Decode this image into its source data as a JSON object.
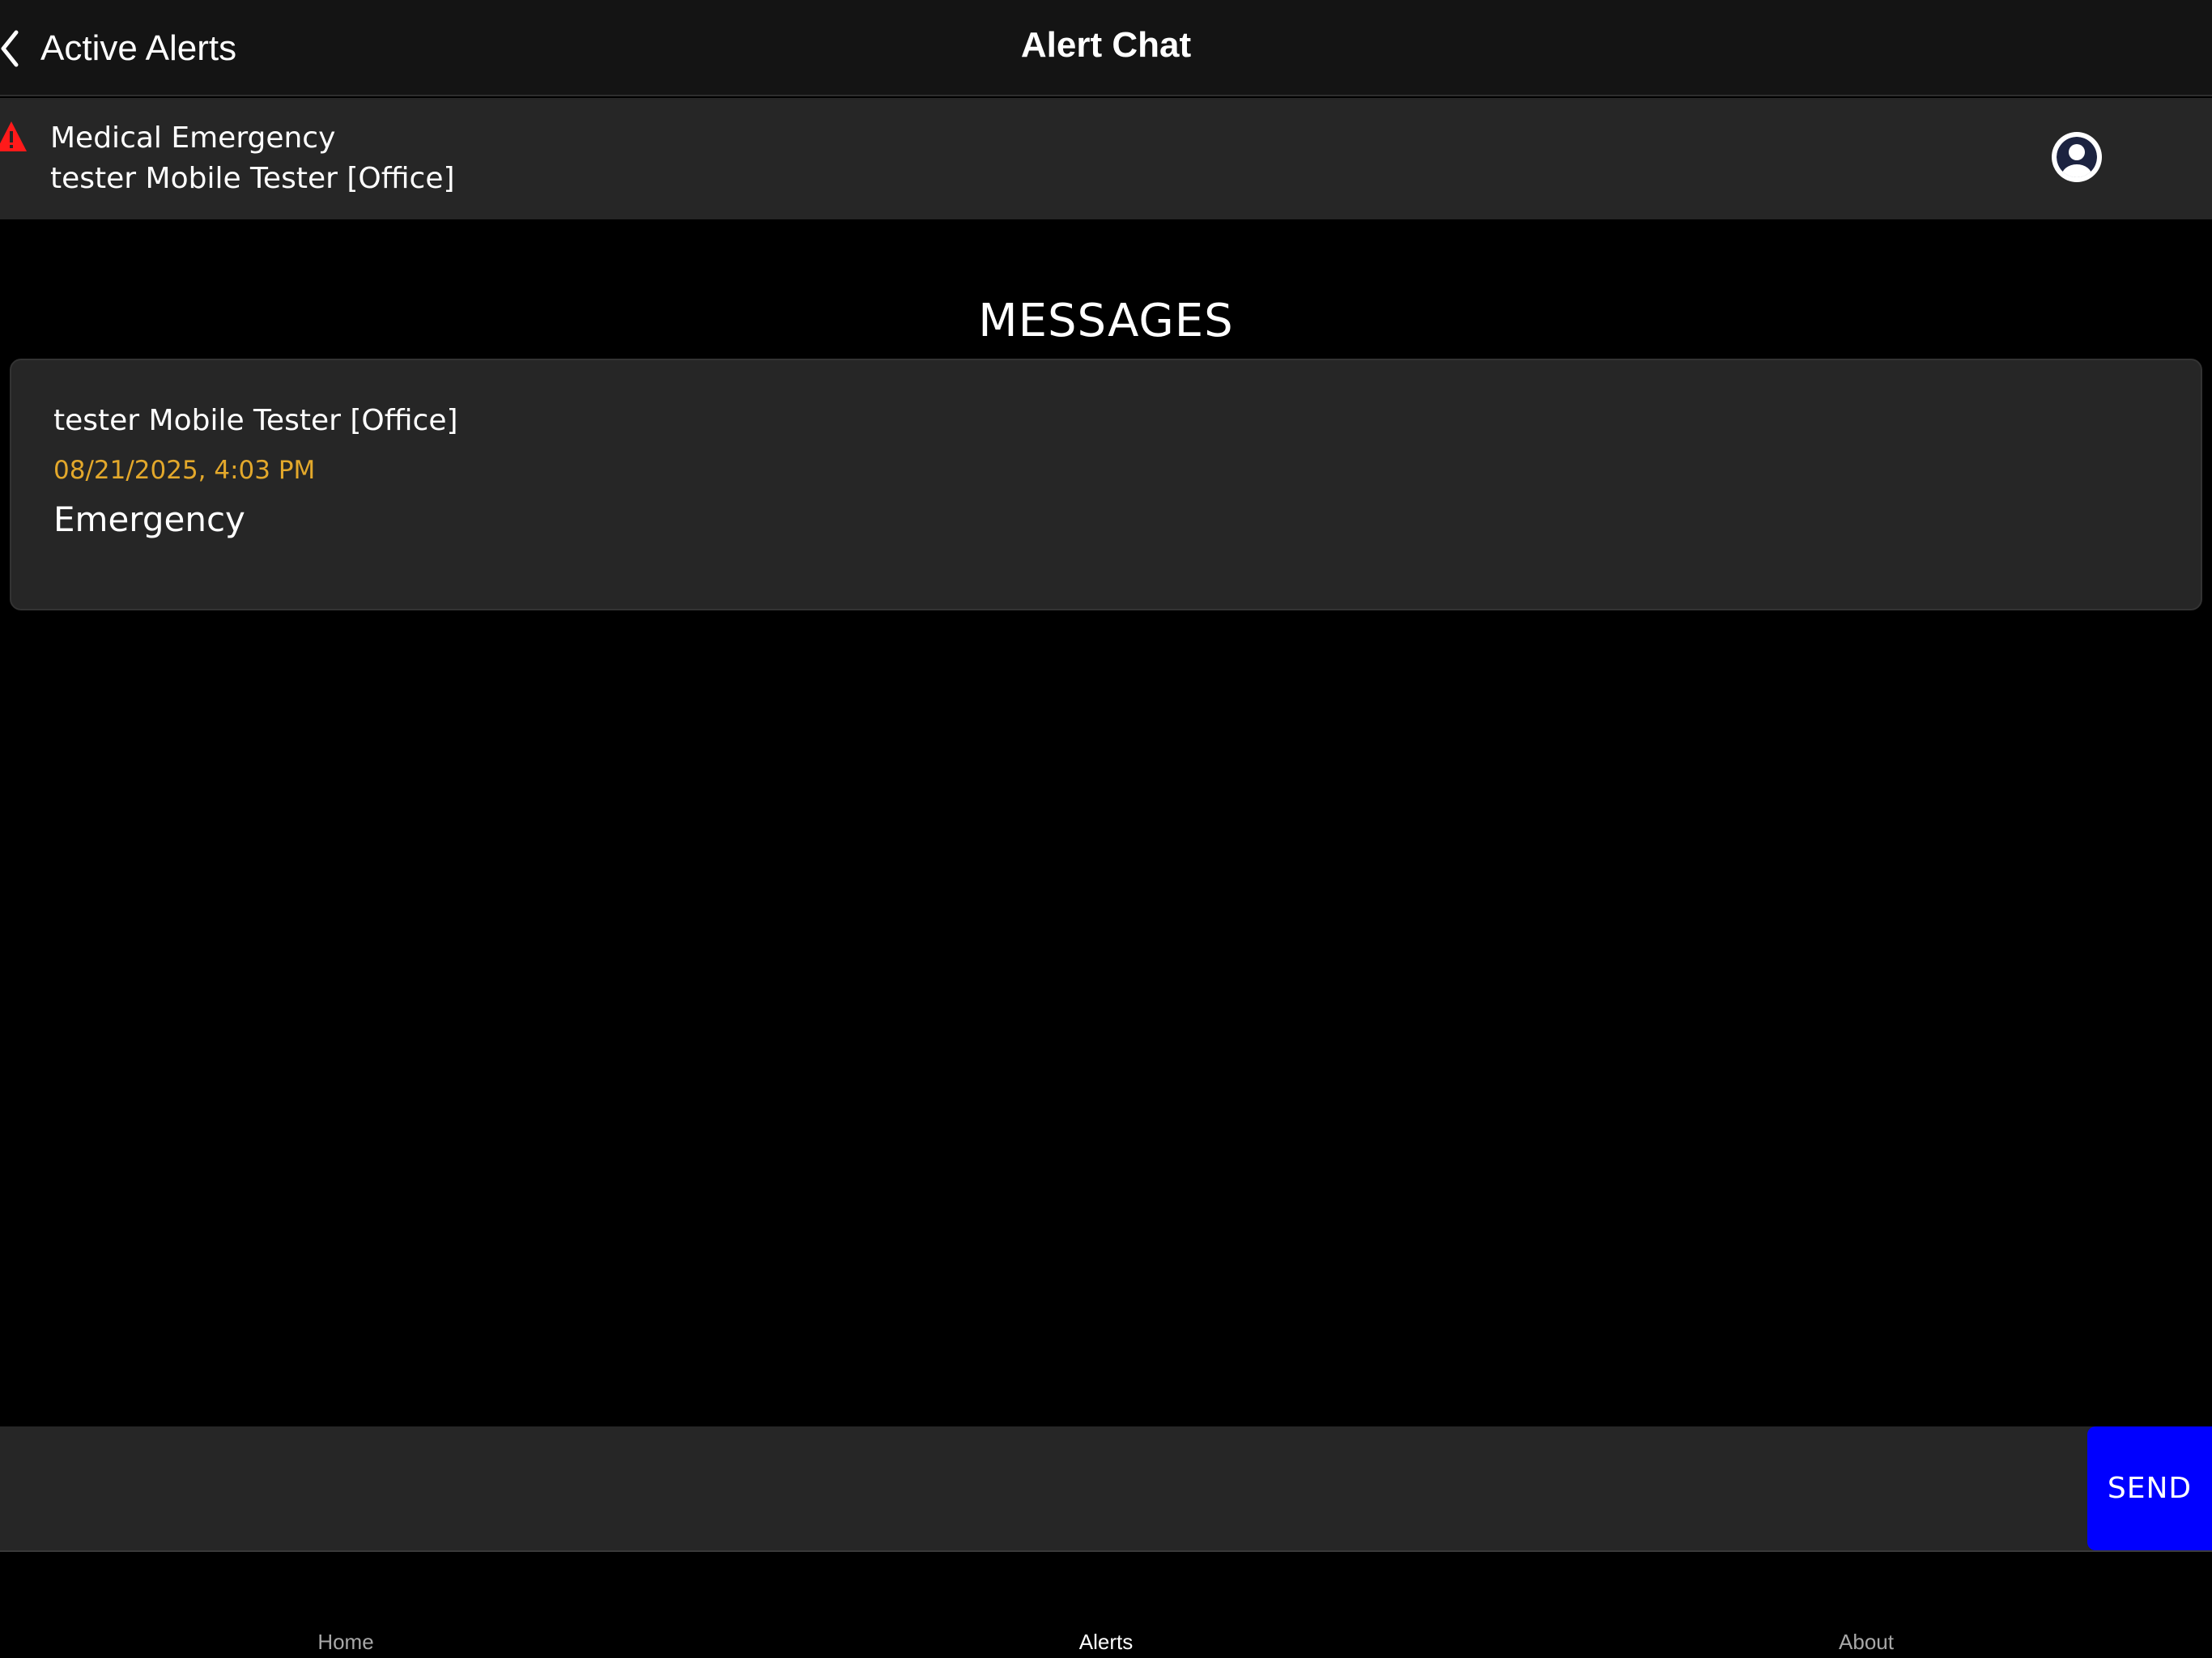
{
  "nav": {
    "back_label": "Active Alerts",
    "title": "Alert Chat"
  },
  "alert": {
    "type": "Medical Emergency",
    "reporter": "tester Mobile Tester [Office]",
    "icon": "warning-icon",
    "icon_color": "#ff1a1a"
  },
  "messages": {
    "heading": "MESSAGES",
    "items": [
      {
        "sender": "tester Mobile Tester [Office]",
        "timestamp": "08/21/2025, 4:03 PM",
        "body": "Emergency"
      }
    ]
  },
  "compose": {
    "value": "",
    "placeholder": "",
    "send_label": "SEND",
    "send_color": "#0000ff"
  },
  "tabs": [
    {
      "label": "Home",
      "active": false
    },
    {
      "label": "Alerts",
      "active": true
    },
    {
      "label": "About",
      "active": false
    }
  ],
  "colors": {
    "timestamp": "#e3a82b",
    "panel": "#262626",
    "background": "#000000"
  }
}
